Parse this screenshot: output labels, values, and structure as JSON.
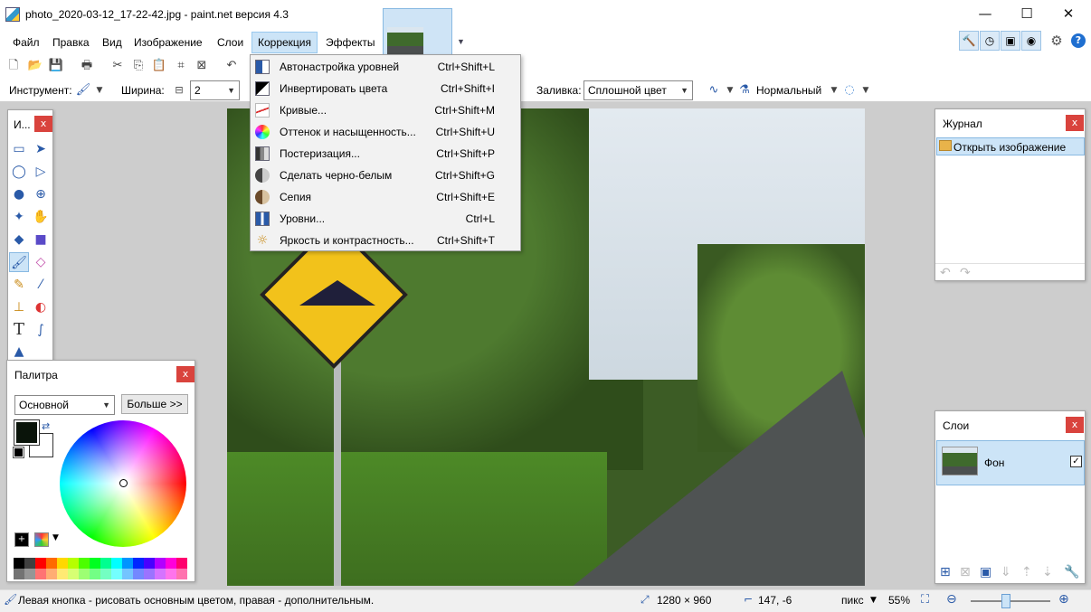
{
  "window": {
    "title": "photo_2020-03-12_17-22-42.jpg - paint.net версия 4.3",
    "minimize": "—",
    "maximize": "☐",
    "close": "✕"
  },
  "menubar": [
    "Файл",
    "Правка",
    "Вид",
    "Изображение",
    "Слои",
    "Коррекция",
    "Эффекты"
  ],
  "toolbar": {
    "tool_label": "Инструмент:",
    "width_label": "Ширина:",
    "width_value": "2",
    "fill_label": "Заливка:",
    "fill_value": "Сплошной цвет",
    "blend_value": "Нормальный"
  },
  "adjustments_menu": [
    {
      "label": "Автонастройка уровней",
      "shortcut": "Ctrl+Shift+L",
      "icon": "auto-level-icon"
    },
    {
      "label": "Инвертировать цвета",
      "shortcut": "Ctrl+Shift+I",
      "icon": "invert-colors-icon"
    },
    {
      "label": "Кривые...",
      "shortcut": "Ctrl+Shift+M",
      "icon": "curves-icon"
    },
    {
      "label": "Оттенок и насыщенность...",
      "shortcut": "Ctrl+Shift+U",
      "icon": "hue-saturation-icon"
    },
    {
      "label": "Постеризация...",
      "shortcut": "Ctrl+Shift+P",
      "icon": "posterize-icon"
    },
    {
      "label": "Сделать черно-белым",
      "shortcut": "Ctrl+Shift+G",
      "icon": "black-white-icon"
    },
    {
      "label": "Сепия",
      "shortcut": "Ctrl+Shift+E",
      "icon": "sepia-icon"
    },
    {
      "label": "Уровни...",
      "shortcut": "Ctrl+L",
      "icon": "levels-icon"
    },
    {
      "label": "Яркость и контрастность...",
      "shortcut": "Ctrl+Shift+T",
      "icon": "brightness-contrast-icon"
    }
  ],
  "tools_panel": {
    "title": "И...",
    "close": "x"
  },
  "palette_panel": {
    "title": "Палитра",
    "close": "x",
    "mode": "Основной",
    "more_button": "Больше >>",
    "primary_color": "#0a140a",
    "secondary_color": "#ffffff",
    "swatches": [
      "#000000",
      "#404040",
      "#ff0000",
      "#ff6a00",
      "#ffd800",
      "#b6ff00",
      "#4cff00",
      "#00ff21",
      "#00ff90",
      "#00ffff",
      "#0094ff",
      "#0026ff",
      "#4800ff",
      "#b200ff",
      "#ff00dc",
      "#ff006e"
    ]
  },
  "history_panel": {
    "title": "Журнал",
    "close": "x",
    "items": [
      "Открыть изображение"
    ]
  },
  "layers_panel": {
    "title": "Слои",
    "close": "x",
    "layers": [
      {
        "name": "Фон",
        "visible": true
      }
    ]
  },
  "statusbar": {
    "hint": "Левая кнопка - рисовать основным цветом, правая - дополнительным.",
    "image_size": "1280 × 960",
    "cursor_pos": "147, -6",
    "units": "пикс",
    "zoom": "55%"
  }
}
